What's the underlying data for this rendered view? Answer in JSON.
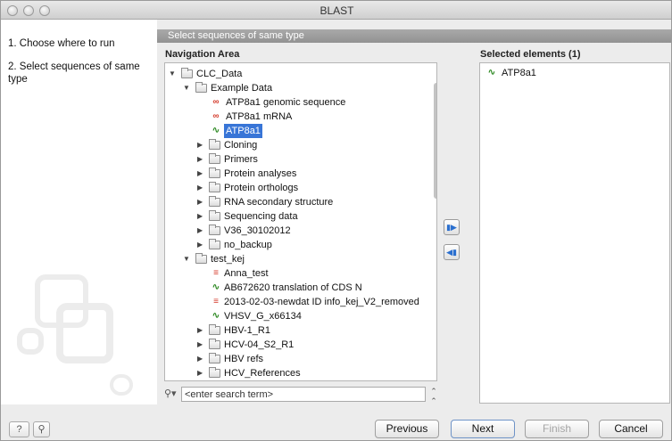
{
  "window": {
    "title": "BLAST"
  },
  "steps": [
    {
      "number": "1.",
      "label": "Choose where to run"
    },
    {
      "number": "2.",
      "label": "Select sequences of same type"
    }
  ],
  "panel": {
    "banner": "Select sequences of same type",
    "nav_header": "Navigation Area",
    "selected_header": "Selected elements (1)"
  },
  "tree": [
    {
      "label": "CLC_Data",
      "icon": "database-folder-icon",
      "expanded": true
    },
    {
      "label": "Example Data",
      "icon": "folder-icon",
      "expanded": true
    },
    {
      "label": "ATP8a1 genomic sequence",
      "icon": "nucleotide-sequence-icon"
    },
    {
      "label": "ATP8a1 mRNA",
      "icon": "nucleotide-sequence-icon"
    },
    {
      "label": "ATP8a1",
      "icon": "protein-sequence-icon",
      "selected": true
    },
    {
      "label": "Cloning",
      "icon": "folder-icon"
    },
    {
      "label": "Primers",
      "icon": "folder-icon"
    },
    {
      "label": "Protein analyses",
      "icon": "folder-icon"
    },
    {
      "label": "Protein orthologs",
      "icon": "folder-icon"
    },
    {
      "label": "RNA secondary structure",
      "icon": "folder-icon"
    },
    {
      "label": "Sequencing data",
      "icon": "folder-icon"
    },
    {
      "label": "V36_30102012",
      "icon": "folder-icon"
    },
    {
      "label": "no_backup",
      "icon": "folder-icon"
    },
    {
      "label": "test_kej",
      "icon": "folder-icon",
      "expanded": true
    },
    {
      "label": "Anna_test",
      "icon": "sequence-list-icon"
    },
    {
      "label": "AB672620 translation of CDS N",
      "icon": "protein-sequence-icon"
    },
    {
      "label": "2013-02-03-newdat ID info_kej_V2_removed",
      "icon": "sequence-list-icon"
    },
    {
      "label": "VHSV_G_x66134",
      "icon": "protein-sequence-icon"
    },
    {
      "label": "HBV-1_R1",
      "icon": "folder-icon"
    },
    {
      "label": "HCV-04_S2_R1",
      "icon": "folder-icon"
    },
    {
      "label": "HBV refs",
      "icon": "folder-icon"
    },
    {
      "label": "HCV_References",
      "icon": "folder-icon"
    }
  ],
  "search": {
    "placeholder": "<enter search term>"
  },
  "selected_elements": [
    {
      "label": "ATP8a1",
      "icon": "protein-sequence-icon"
    }
  ],
  "footer": {
    "help": "?",
    "previous": "Previous",
    "next": "Next",
    "finish": "Finish",
    "cancel": "Cancel"
  },
  "colors": {
    "selection": "#3875d7",
    "nucleotide_icon": "#d43a2a",
    "protein_icon": "#2f8a24",
    "move_arrow": "#2a6fcf"
  }
}
